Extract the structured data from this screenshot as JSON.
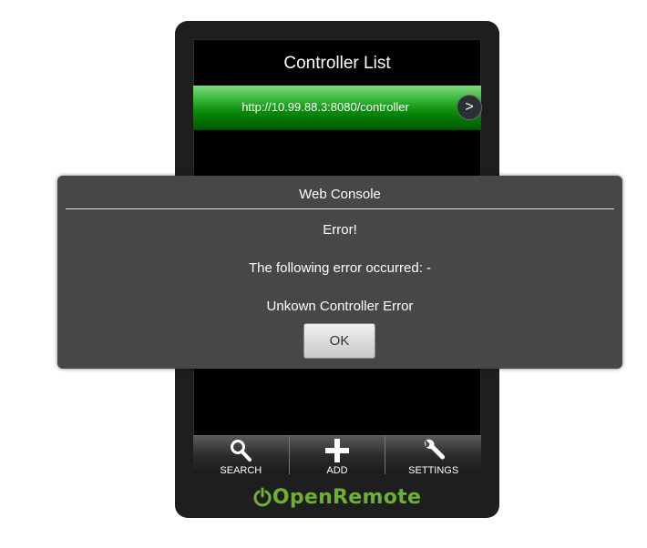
{
  "list": {
    "title": "Controller List",
    "controller_url": "http://10.99.88.3:8080/controller",
    "go_glyph": ">"
  },
  "tabs": [
    {
      "label": "SEARCH",
      "icon": "search-icon"
    },
    {
      "label": "ADD",
      "icon": "plus-icon"
    },
    {
      "label": "SETTINGS",
      "icon": "wrench-icon"
    }
  ],
  "logo": {
    "text": "OpenRemote",
    "color": "#6fb034"
  },
  "dialog": {
    "title": "Web Console",
    "heading": "Error!",
    "message": "The following error occurred: -",
    "detail": "Unkown Controller Error",
    "ok_label": "OK"
  },
  "colors": {
    "accent_green": "#0a8a0a",
    "dialog_bg": "#474747"
  }
}
